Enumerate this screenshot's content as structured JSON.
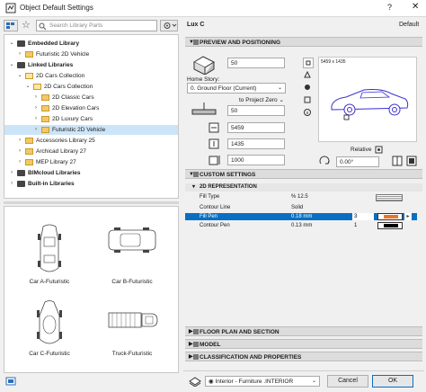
{
  "window": {
    "title": "Object Default Settings",
    "help": "?",
    "close": "✕"
  },
  "toolbar": {
    "search_placeholder": "Search Library Parts"
  },
  "header": {
    "object_name": "Lux C",
    "default_label": "Default"
  },
  "tree": [
    {
      "label": "Embedded Library",
      "bold": true,
      "expanded": true
    },
    {
      "label": "Futuristic 2D Vehicle"
    },
    {
      "label": "Linked Libraries",
      "bold": true,
      "expanded": true
    },
    {
      "label": "2D Cars Collection",
      "expanded": true
    },
    {
      "label": "2D Cars Collection",
      "expanded": true
    },
    {
      "label": "2D Classic Cars"
    },
    {
      "label": "2D Elevation Cars"
    },
    {
      "label": "2D Luxury Cars"
    },
    {
      "label": "Futuristic 2D Vehicle",
      "selected": true
    },
    {
      "label": "Accessories Library 25"
    },
    {
      "label": "Archicad Library 27"
    },
    {
      "label": "MEP Library 27"
    },
    {
      "label": "BIMcloud Libraries",
      "bold": true
    },
    {
      "label": "Built-in Libraries",
      "bold": true
    }
  ],
  "thumbnails": [
    {
      "label": "Car A-Futuristic"
    },
    {
      "label": "Car B-Futuristic"
    },
    {
      "label": "Car C-Futuristic"
    },
    {
      "label": "Truck-Futuristic"
    }
  ],
  "preview": {
    "section_title": "PREVIEW AND POSITIONING",
    "elevation_value": "50",
    "home_story_label": "Home Story:",
    "home_story_value": "0. Ground Floor (Current)",
    "to_project_zero": "to Project Zero",
    "project_zero_value": "50",
    "width_value": "5459",
    "depth_value": "1435",
    "height_value": "1000",
    "preview_caption": "5459 x 1435",
    "relative_label": "Relative",
    "angle_value": "0.00°"
  },
  "custom": {
    "section_title": "CUSTOM SETTINGS",
    "subsection": "2D REPRESENTATION",
    "params": [
      {
        "name": "Fill Type",
        "value": "%  12.5"
      },
      {
        "name": "Contour Line",
        "value": "Solid"
      },
      {
        "name": "Fill Pen",
        "value": "0.18 mm",
        "pen": "3",
        "selected": true
      },
      {
        "name": "Contour Pen",
        "value": "0.13 mm",
        "pen": "1"
      }
    ]
  },
  "collapsed_sections": [
    {
      "label": "FLOOR PLAN AND SECTION"
    },
    {
      "label": "MODEL"
    },
    {
      "label": "CLASSIFICATION AND PROPERTIES"
    }
  ],
  "footer": {
    "layer_value": "Interior - Furniture .INTERIOR",
    "cancel_label": "Cancel",
    "ok_label": "OK"
  },
  "colors": {
    "selection": "#0a6fc2",
    "tree_selection": "#cce4f7",
    "fill_pen": "#e8772e"
  }
}
